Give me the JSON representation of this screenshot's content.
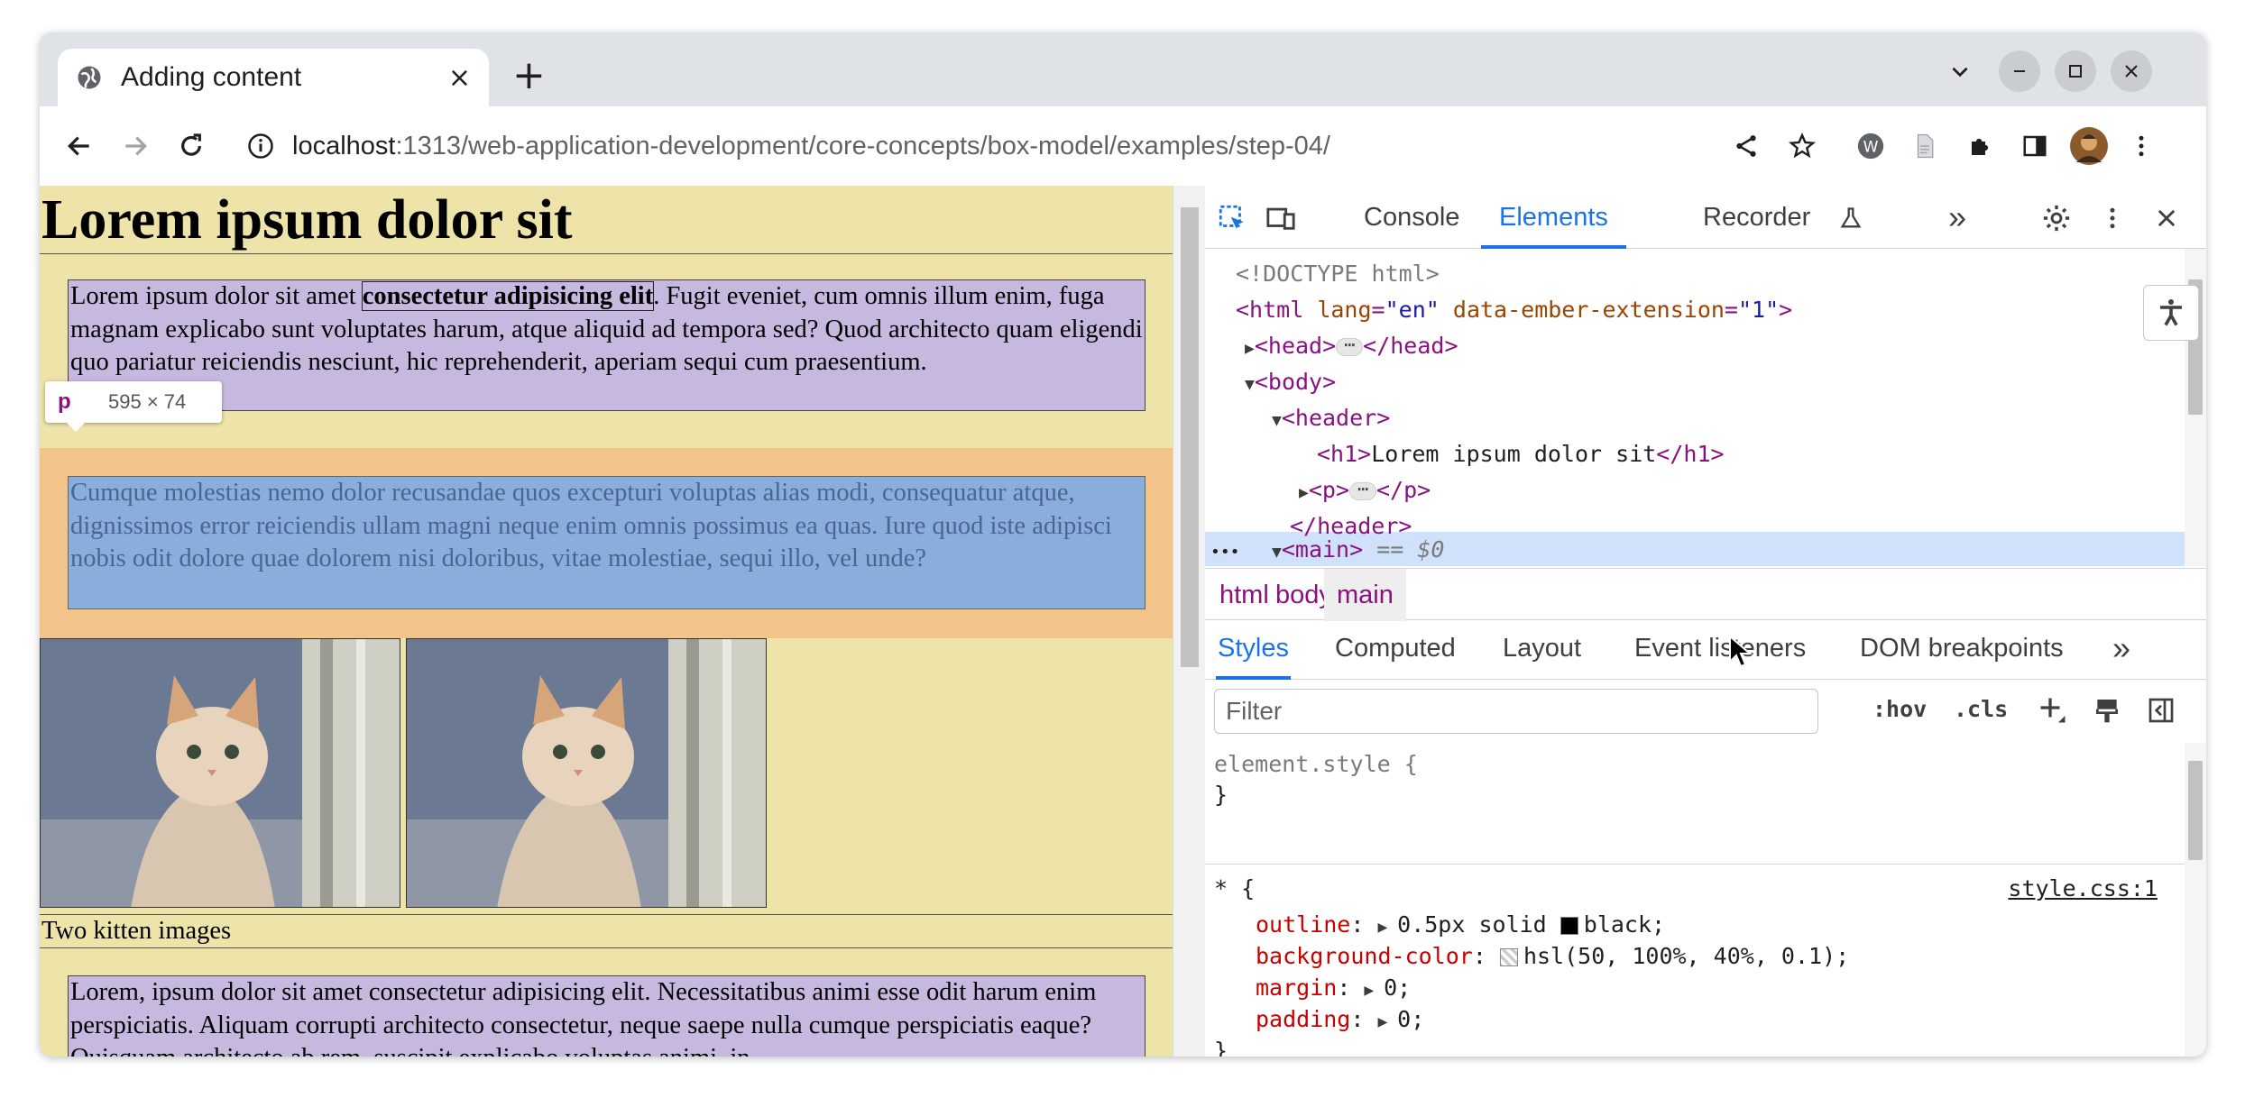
{
  "browser": {
    "tab_title": "Adding content",
    "tab_close": "×",
    "new_tab": "+",
    "url_host": "localhost",
    "url_rest": ":1313/web-application-development/core-concepts/box-model/examples/step-04/"
  },
  "page": {
    "heading": "Lorem ipsum dolor sit",
    "p1_before": "Lorem ipsum dolor sit amet ",
    "p1_strong": "consectetur adipisicing elit",
    "p1_after": ". Fugit eveniet, cum omnis illum enim, fuga magnam explicabo sunt voluptates harum, atque aliquid ad tempora sed? Quod architecto quam eligendi quo pariatur reiciendis nesciunt, hic reprehenderit, aperiam sequi cum praesentium.",
    "p2": "Cumque molestias nemo dolor recusandae quos excepturi voluptas alias modi, consequatur atque, dignissimos error reiciendis ullam magni neque enim omnis possimus ea quas. Iure quod iste adipisci nobis odit dolore quae dolorem nisi doloribus, vitae molestiae, sequi illo, vel unde?",
    "caption": "Two kitten images",
    "p3": "Lorem, ipsum dolor sit amet consectetur adipisicing elit. Necessitatibus animi esse odit harum enim perspiciatis. Aliquam corrupti architecto consectetur, neque saepe nulla cumque perspiciatis eaque? Quisquam architecto ab rem, suscipit explicabo voluptas animi, in",
    "tooltip_tag": "p",
    "tooltip_dims": "595 × 74"
  },
  "devtools": {
    "tabs": [
      "Console",
      "Elements",
      "Recorder"
    ],
    "more": "»",
    "dom": {
      "doctype": "<!DOCTYPE html>",
      "html_open_tag": "<html",
      "html_attr1": "lang",
      "html_attr1_val": "\"en\"",
      "html_attr2": "data-ember-extension",
      "html_attr2_val": "\"1\"",
      "head": "<head>",
      "head_close": "</head>",
      "body": "<body>",
      "header": "<header>",
      "h1_open": "<h1>",
      "h1_text": "Lorem ipsum dolor sit",
      "h1_close": "</h1>",
      "p_open": "<p>",
      "p_close": "</p>",
      "header_close": "</header>",
      "main": "<main>",
      "main_marker": "== $0",
      "row_dots": "•••"
    },
    "breadcrumbs": [
      "html",
      "body",
      "main"
    ],
    "subtabs": [
      "Styles",
      "Computed",
      "Layout",
      "Event listeners",
      "DOM breakpoints"
    ],
    "filter_placeholder": "Filter",
    "hov": ":hov",
    "cls": ".cls",
    "styles": {
      "element_style": "element.style {",
      "close_brace": "}",
      "universal": "* {",
      "source": "style.css:1",
      "rules": [
        {
          "prop": "outline",
          "val": "0.5px solid ",
          "tail": "black;"
        },
        {
          "prop": "background-color",
          "val": "",
          "tail": "hsl(50, 100%, 40%, 0.1);"
        },
        {
          "prop": "margin",
          "val": "",
          "tail": "0;"
        },
        {
          "prop": "padding",
          "val": "",
          "tail": "0;"
        }
      ]
    }
  }
}
